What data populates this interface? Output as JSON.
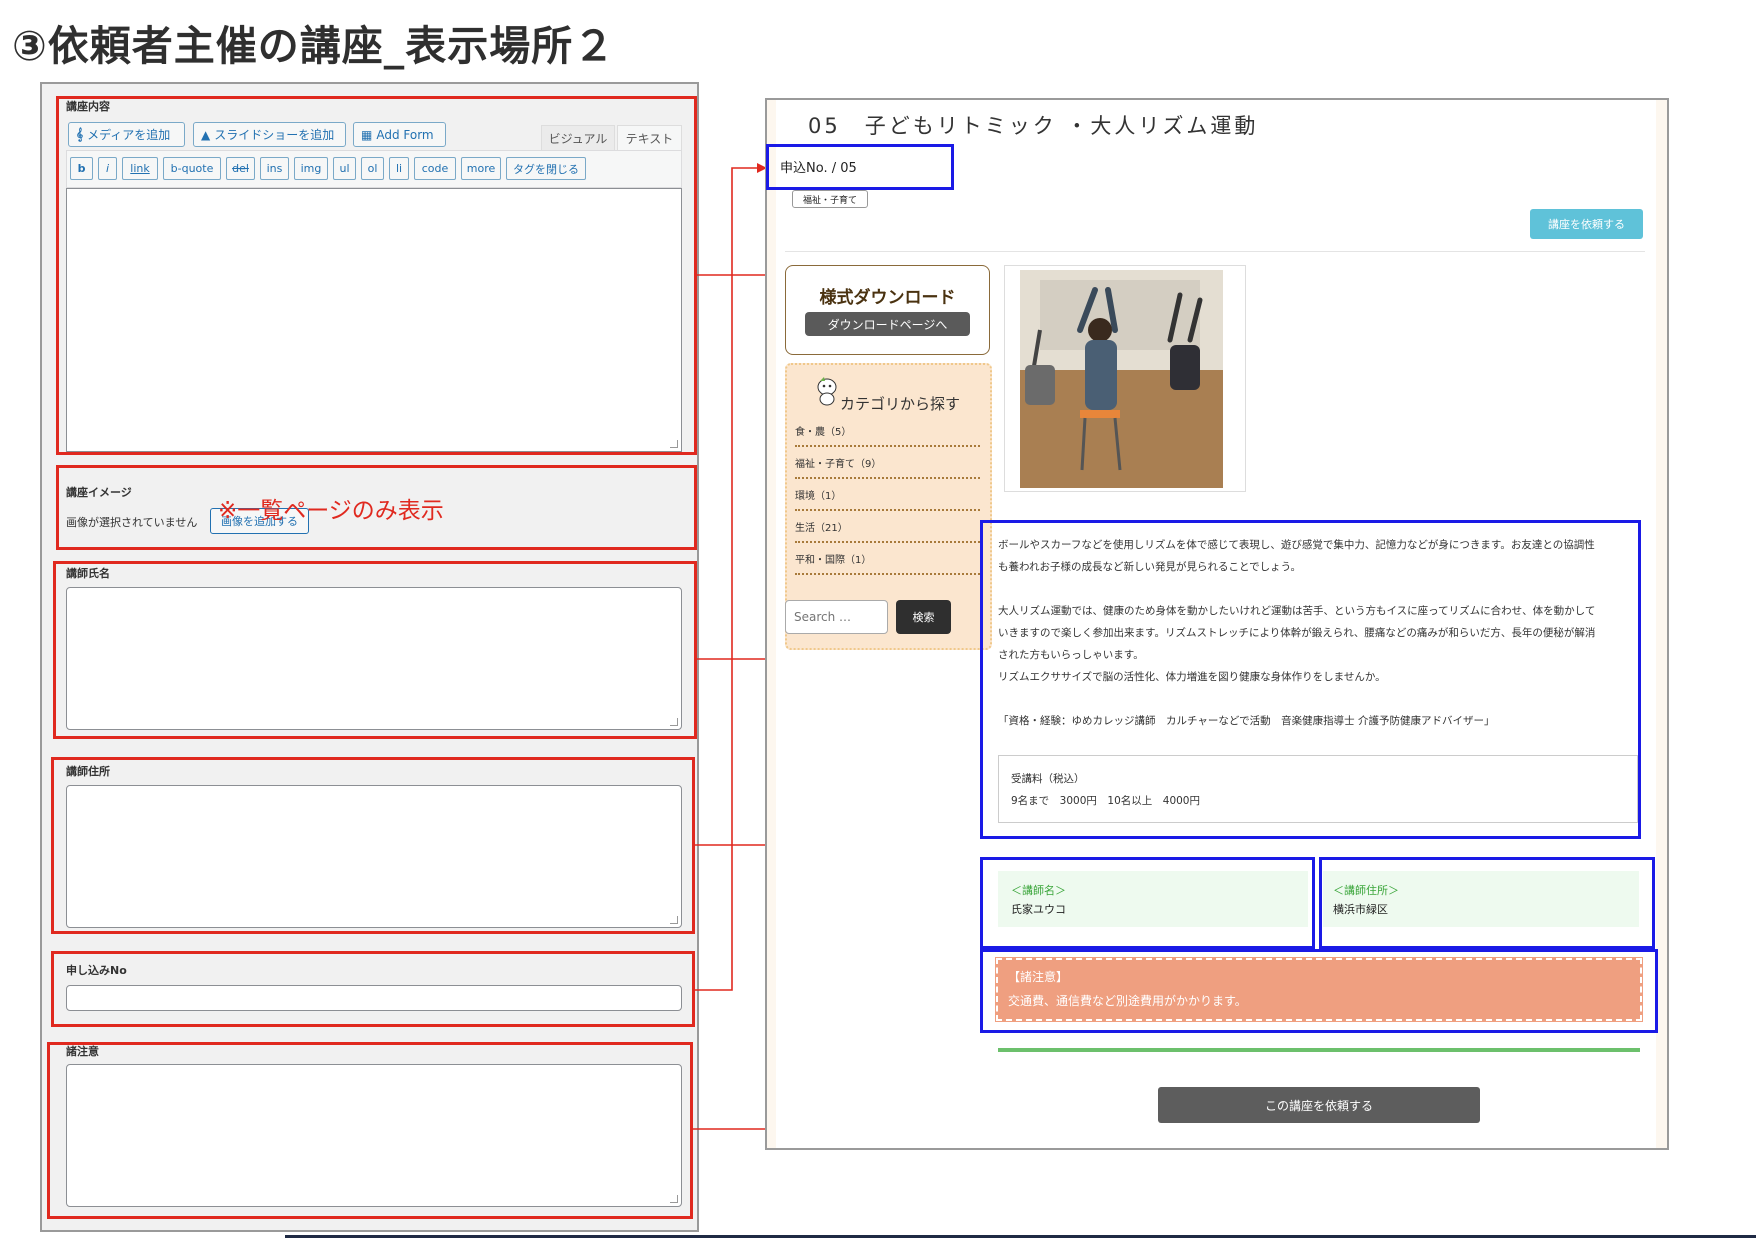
{
  "slide": {
    "title": "③依頼者主催の講座_表示場所２"
  },
  "editor": {
    "content_label": "講座内容",
    "toolbar": {
      "add_media": "メディアを追加",
      "add_slideshow": "スライドショーを追加",
      "add_form": "Add Form"
    },
    "tabs": {
      "visual": "ビジュアル",
      "text": "テキスト"
    },
    "quicktags": [
      "b",
      "i",
      "link",
      "b-quote",
      "del",
      "ins",
      "img",
      "ul",
      "ol",
      "li",
      "code",
      "more",
      "タグを閉じる"
    ],
    "image_label": "講座イメージ",
    "image_status": "画像が選択されていません",
    "add_image_button": "画像を追加する",
    "image_note": "※一覧ページのみ表示",
    "instructor_name_label": "講師氏名",
    "instructor_address_label": "講師住所",
    "application_no_label": "申し込みNo",
    "notes_label": "諸注意"
  },
  "preview": {
    "lecture_title": "05　子どもリトミック ・大人リズム運動",
    "application_no": "申込No. / 05",
    "tag": "福祉・子育て",
    "request_button_top": "講座を依頼する",
    "download": {
      "title": "様式ダウンロード",
      "button": "ダウンロードページへ"
    },
    "category": {
      "title": "カテゴリから探す",
      "items": [
        "食・農（5）",
        "福祉・子育て（9）",
        "環境（1）",
        "生活（21）",
        "平和・国際（1）"
      ]
    },
    "search": {
      "placeholder": "Search …",
      "button": "検索"
    },
    "description": [
      "ボールやスカーフなどを使用しリズムを体で感じて表現し、遊び感覚で集中力、記憶力などが身につきます。お友達との協調性",
      "も養われお子様の成長など新しい発見が見られることでしょう。",
      "",
      "大人リズム運動では、健康のため身体を動かしたいけれど運動は苦手、という方もイスに座ってリズムに合わせ、体を動かして",
      "いきますので楽しく参加出来ます。リズムストレッチにより体幹が鍛えられ、腰痛などの痛みが和らいだ方、長年の便秘が解消",
      "された方もいらっしゃいます。",
      "リズムエクササイズで脳の活性化、体力増進を図り健康な身体作りをしませんか。",
      "",
      "「資格・経験：ゆめカレッジ講師　カルチャーなどで活動　音楽健康指導士 介護予防健康アドバイザー」"
    ],
    "fee": {
      "label": "受講料（税込）",
      "value": "9名まで　3000円　10名以上　4000円"
    },
    "instructor": {
      "name_heading": "＜講師名＞",
      "name": "氏家ユウコ",
      "address_heading": "＜講師住所＞",
      "address": "横浜市緑区"
    },
    "notes": {
      "heading": "【諸注意】",
      "text": "交通費、通信費など別途費用がかかります。"
    },
    "request_button_bottom": "この講座を依頼する"
  },
  "colors": {
    "highlight_red": "#e0291f",
    "highlight_blue": "#1a1ae6",
    "request_button": "#5fc2d9",
    "note_bg": "#ef9f80",
    "instructor_bg": "#eefaef"
  }
}
